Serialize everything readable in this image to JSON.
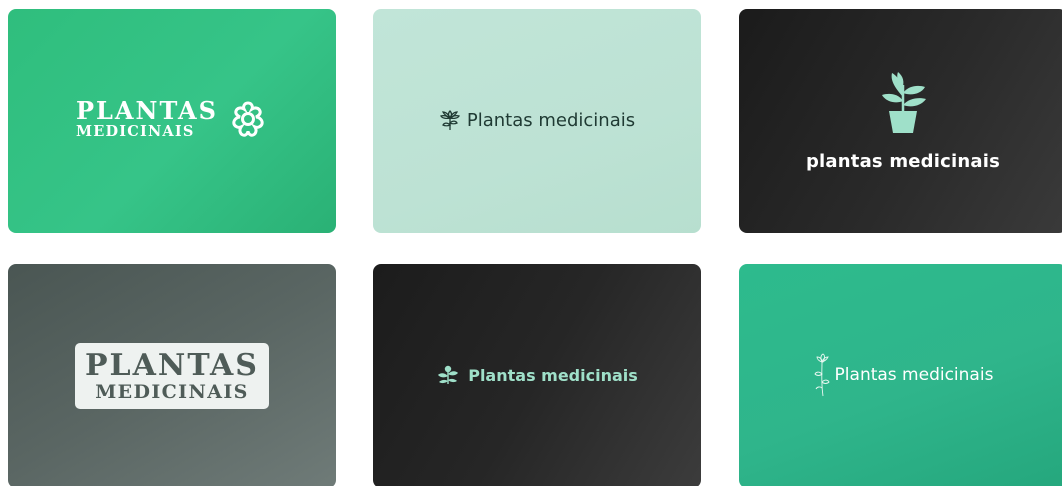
{
  "cards": [
    {
      "line1": "PLANTAS",
      "line2": "MEDICINAIS",
      "icon": "flower-icon",
      "background": "#31c083",
      "text_color": "#ffffff"
    },
    {
      "text": "Plantas medicinais",
      "icon": "lotus-icon",
      "background": "#bfe3d5",
      "text_color": "#1f3a33"
    },
    {
      "text": "plantas medicinais",
      "icon": "potted-plant-icon",
      "background": "#252525",
      "text_color": "#ffffff",
      "icon_color": "#9fe0c9"
    },
    {
      "line1": "PLANTAS",
      "line2": "MEDICINAIS",
      "background": "#5a6663",
      "box_color": "#eef2f0",
      "text_color": "#4f5c58"
    },
    {
      "text": "Plantas medicinais",
      "icon": "herb-icon",
      "background": "#262626",
      "text_color": "#9fe0c9"
    },
    {
      "text": "Plantas medicinais",
      "icon": "flower-stem-icon",
      "background": "#2db58a",
      "text_color": "#ffffff"
    }
  ]
}
